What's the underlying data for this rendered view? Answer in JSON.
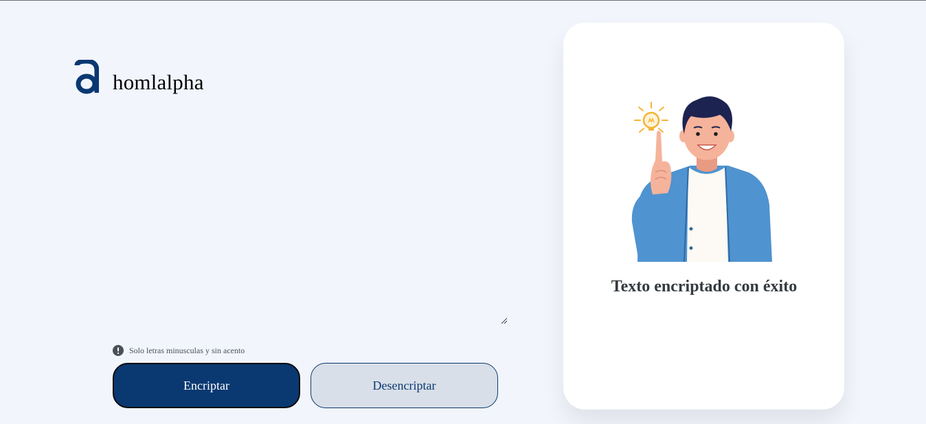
{
  "brand": {
    "logo_icon": "alpha-a-logo-icon",
    "name": "homlalpha"
  },
  "input": {
    "value": "",
    "placeholder": ""
  },
  "hint": {
    "icon": "exclamation-circle-icon",
    "text": "Solo letras minusculas y sin acento"
  },
  "buttons": {
    "encrypt_label": "Encriptar",
    "decrypt_label": "Desencriptar"
  },
  "result_card": {
    "illustration": "man-with-idea-lightbulb",
    "message": "Texto encriptado con éxito"
  },
  "colors": {
    "page_background": "#f2f5fc",
    "primary": "#0a3871",
    "secondary_button": "#d8dfe8",
    "card": "#ffffff",
    "text_dark": "#343a40"
  }
}
